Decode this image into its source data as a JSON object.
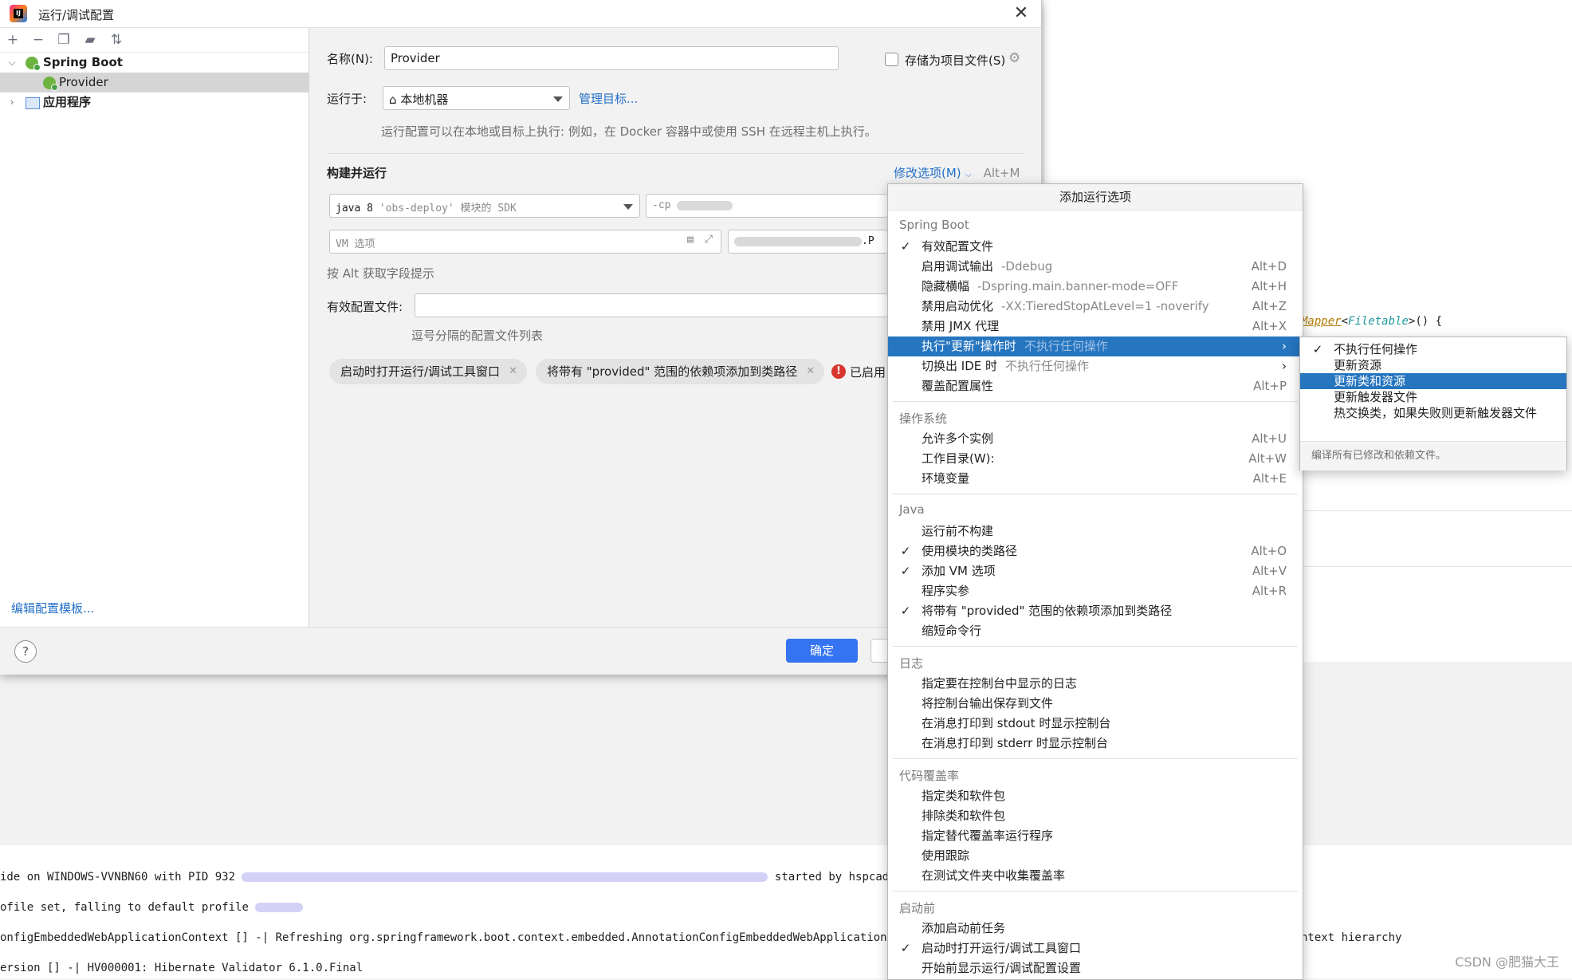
{
  "window": {
    "title": "运行/调试配置",
    "app_logo_text": "IJ"
  },
  "tree": {
    "toolbar": [
      "add-icon",
      "remove-icon",
      "copy-icon",
      "folder-icon",
      "sort-icon"
    ],
    "groups": [
      {
        "label": "Spring Boot",
        "icon": "spring-boot-icon",
        "children": [
          "Provider"
        ]
      },
      {
        "label": "应用程序",
        "icon": "application-icon"
      }
    ],
    "edit_templates": "编辑配置模板..."
  },
  "form": {
    "name_label": "名称(N):",
    "name_value": "Provider",
    "store_as_file": "存储为项目文件(S)",
    "run_on_label": "运行于:",
    "run_on_value": "本地机器",
    "manage_targets": "管理目标...",
    "run_on_hint": "运行配置可以在本地或目标上执行: 例如，在 Docker 容器中或使用 SSH 在远程主机上执行。",
    "build_run_title": "构建并运行",
    "modify_options": "修改选项(M)",
    "modify_options_key": "Alt+M",
    "sdk_java": "java 8",
    "sdk_module": "'obs-deploy'",
    "sdk_suffix": "模块的 SDK",
    "cp_prefix": "-cp",
    "vm_placeholder": "VM 选项",
    "main_class_suffix": ".P",
    "alt_hint": "按 Alt 获取字段提示",
    "active_profiles_label": "有效配置文件:",
    "active_profiles_hint": "逗号分隔的配置文件列表",
    "chips": [
      "启动时打开运行/调试工具窗口",
      "将带有 \"provided\" 范围的依赖项添加到类路径"
    ],
    "error_text": "已启用",
    "ok": "确定"
  },
  "menu": {
    "header": "添加运行选项",
    "sections": [
      {
        "title": "Spring Boot",
        "items": [
          {
            "label": "有效配置文件",
            "checked": true
          },
          {
            "label": "启用调试输出",
            "sub": "-Ddebug",
            "key": "Alt+D"
          },
          {
            "label": "隐藏横幅",
            "sub": "-Dspring.main.banner-mode=OFF",
            "key": "Alt+H"
          },
          {
            "label": "禁用启动优化",
            "sub": "-XX:TieredStopAtLevel=1 -noverify",
            "key": "Alt+Z"
          },
          {
            "label": "禁用 JMX 代理",
            "key": "Alt+X"
          },
          {
            "label": "执行\"更新\"操作时",
            "sub": "不执行任何操作",
            "submenu": true,
            "highlighted": true
          },
          {
            "label": "切换出 IDE 时",
            "sub": "不执行任何操作",
            "submenu": true
          },
          {
            "label": "覆盖配置属性",
            "key": "Alt+P"
          }
        ]
      },
      {
        "title": "操作系统",
        "items": [
          {
            "label": "允许多个实例",
            "key": "Alt+U"
          },
          {
            "label": "工作目录(W):",
            "key": "Alt+W"
          },
          {
            "label": "环境变量",
            "key": "Alt+E"
          }
        ]
      },
      {
        "title": "Java",
        "items": [
          {
            "label": "运行前不构建"
          },
          {
            "label": "使用模块的类路径",
            "checked": true,
            "key": "Alt+O"
          },
          {
            "label": "添加 VM 选项",
            "checked": true,
            "key": "Alt+V"
          },
          {
            "label": "程序实参",
            "key": "Alt+R"
          },
          {
            "label": "将带有 \"provided\" 范围的依赖项添加到类路径",
            "checked": true
          },
          {
            "label": "缩短命令行"
          }
        ]
      },
      {
        "title": "日志",
        "items": [
          {
            "label": "指定要在控制台中显示的日志"
          },
          {
            "label": "将控制台输出保存到文件"
          },
          {
            "label": "在消息打印到 stdout 时显示控制台"
          },
          {
            "label": "在消息打印到 stderr 时显示控制台"
          }
        ]
      },
      {
        "title": "代码覆盖率",
        "items": [
          {
            "label": "指定类和软件包"
          },
          {
            "label": "排除类和软件包"
          },
          {
            "label": "指定替代覆盖率运行程序"
          },
          {
            "label": "使用跟踪"
          },
          {
            "label": "在测试文件夹中收集覆盖率"
          }
        ]
      },
      {
        "title": "启动前",
        "items": [
          {
            "label": "添加启动前任务"
          },
          {
            "label": "启动时打开运行/调试工具窗口",
            "checked": true
          },
          {
            "label": "开始前显示运行/调试配置设置"
          }
        ]
      }
    ]
  },
  "submenu": {
    "items": [
      {
        "label": "不执行任何操作",
        "checked": true
      },
      {
        "label": "更新资源"
      },
      {
        "label": "更新类和资源",
        "highlighted": true
      },
      {
        "label": "更新触发器文件"
      },
      {
        "label": "热交换类，如果失败则更新触发器文件"
      }
    ],
    "description": "编译所有已修改和依赖文件。"
  },
  "background": {
    "code_class": "Mapper",
    "code_generic": "Filetable",
    "code_tail": "() {",
    "console": [
      {
        "a": "ide",
        "b": "on WINDOWS-VVNBN60 with PID 932",
        "c": "started by hspcadm"
      },
      {
        "a": "ofile set, falling",
        "b": "to default profile",
        "c": ""
      },
      {
        "a": "onfigEmbeddedWebApplicationContext [] -| Refreshing org.springframework.boot.context.embedded.AnnotationConfigEmbeddedWebApplicationContext",
        "b": "ntext hierarchy",
        "c": ""
      },
      {
        "a": "ersion [] -| HV000001: Hibernate Validator 6.1.0.Final",
        "b": "",
        "c": ""
      }
    ],
    "watermark": "CSDN @肥猫大王"
  },
  "colors": {
    "accent": "#3574f0",
    "selection": "#2675bf",
    "link": "#2470c7",
    "error": "#d9352f"
  }
}
